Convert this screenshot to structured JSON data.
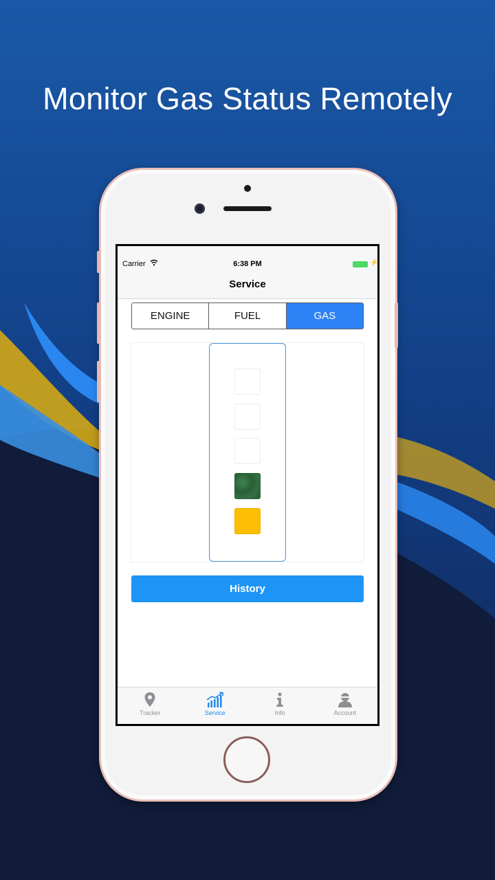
{
  "headline": "Monitor Gas Status Remotely",
  "colors": {
    "background_top": "#1a56a3",
    "background_bottom": "#101c3a",
    "accent": "#2d82f5",
    "level_green": "#2f6b3d",
    "level_yellow": "#fbbe03"
  },
  "status_bar": {
    "carrier": "Carrier",
    "time": "6:38 PM",
    "battery_icon": "battery-charging-icon",
    "wifi_icon": "wifi-icon"
  },
  "nav": {
    "title": "Service"
  },
  "segments": [
    {
      "label": "ENGINE",
      "selected": false
    },
    {
      "label": "FUEL",
      "selected": false
    },
    {
      "label": "GAS",
      "selected": true
    }
  ],
  "gas_gauge": {
    "levels": [
      {
        "state": "empty"
      },
      {
        "state": "empty"
      },
      {
        "state": "empty"
      },
      {
        "state": "green"
      },
      {
        "state": "yellow"
      }
    ],
    "filled_count": 2,
    "total_count": 5
  },
  "history_button": {
    "label": "History"
  },
  "tabs": [
    {
      "label": "Tracker",
      "icon": "location-pin-icon",
      "active": false
    },
    {
      "label": "Service",
      "icon": "chart-bars-icon",
      "active": true
    },
    {
      "label": "Info",
      "icon": "info-icon",
      "active": false
    },
    {
      "label": "Account",
      "icon": "user-icon",
      "active": false
    }
  ]
}
